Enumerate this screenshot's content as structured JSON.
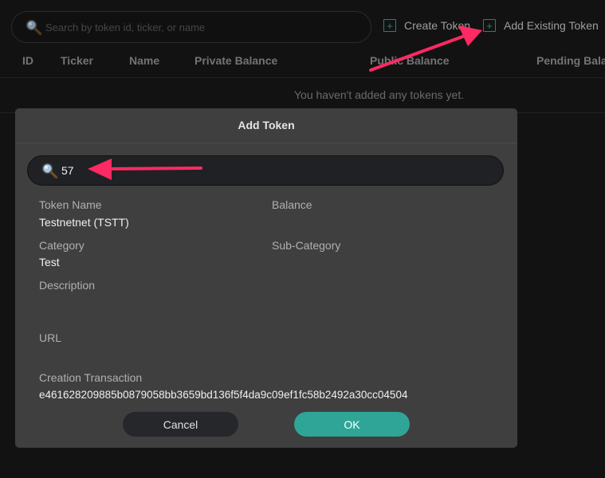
{
  "search": {
    "placeholder": "Search by token id, ticker, or name"
  },
  "actions": {
    "create_token": "Create Token",
    "add_existing": "Add Existing Token"
  },
  "table": {
    "headers": [
      "ID",
      "Ticker",
      "Name",
      "Private Balance",
      "Public Balance",
      "Pending Bala"
    ],
    "empty_message": "You haven't added any tokens yet."
  },
  "modal": {
    "title": "Add Token",
    "search_value": "57",
    "fields": {
      "token_name_label": "Token Name",
      "token_name_value": "Testnetnet (TSTT)",
      "balance_label": "Balance",
      "category_label": "Category",
      "category_value": "Test",
      "subcategory_label": "Sub-Category",
      "description_label": "Description",
      "url_label": "URL",
      "creation_tx_label": "Creation Transaction",
      "creation_tx_value": "e461628209885b0879058bb3659bd136f5f4da9c09ef1fc58b2492a30cc04504"
    },
    "buttons": {
      "cancel": "Cancel",
      "ok": "OK"
    }
  },
  "colors": {
    "accent": "#2fa598",
    "annotation_arrow": "#ff2a63",
    "background": "#191919",
    "modal_bg": "#3f3f3f"
  }
}
